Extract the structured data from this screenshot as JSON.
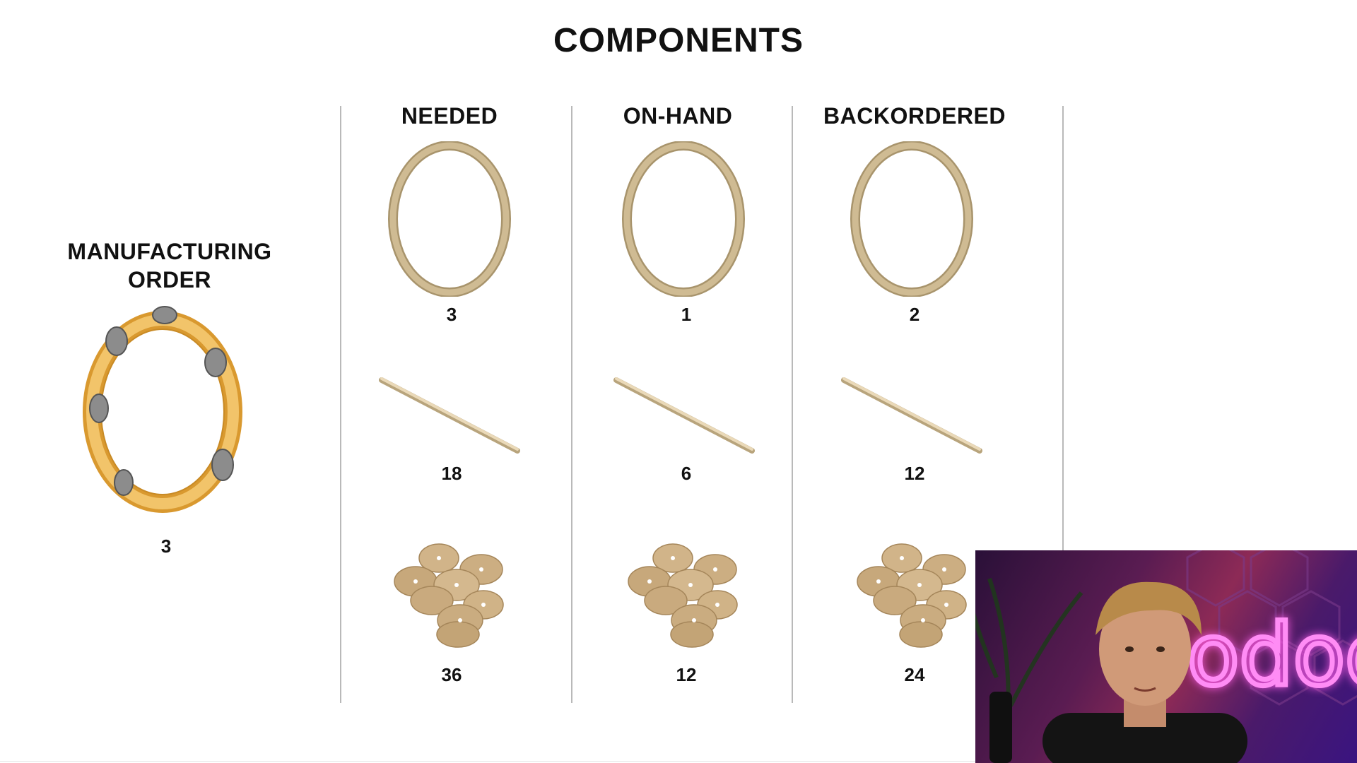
{
  "title": "COMPONENTS",
  "manufacturing_order": {
    "label_line1": "MANUFACTURING",
    "label_line2": "ORDER",
    "quantity": "3",
    "icon": "tambourine-icon"
  },
  "columns": [
    {
      "header": "NEEDED",
      "quantities": {
        "hoop": "3",
        "stick": "18",
        "jingles": "36"
      }
    },
    {
      "header": "ON-HAND",
      "quantities": {
        "hoop": "1",
        "stick": "6",
        "jingles": "12"
      }
    },
    {
      "header": "BACKORDERED",
      "quantities": {
        "hoop": "2",
        "stick": "12",
        "jingles": "24"
      }
    }
  ],
  "components": [
    {
      "id": "hoop",
      "icon": "wooden-hoop-icon"
    },
    {
      "id": "stick",
      "icon": "wooden-stick-icon"
    },
    {
      "id": "jingles",
      "icon": "metal-jingles-icon"
    }
  ],
  "webcam": {
    "neon_sign": "odoo",
    "colors": {
      "neon": "#ff8cf5",
      "wall": "#5a1c52"
    }
  },
  "colors": {
    "wood": "#c9b48e",
    "wood_dark": "#a8946c",
    "tambourine": "#e9b24c",
    "jingle": "#c6a97a",
    "divider": "#b9b9b9"
  }
}
